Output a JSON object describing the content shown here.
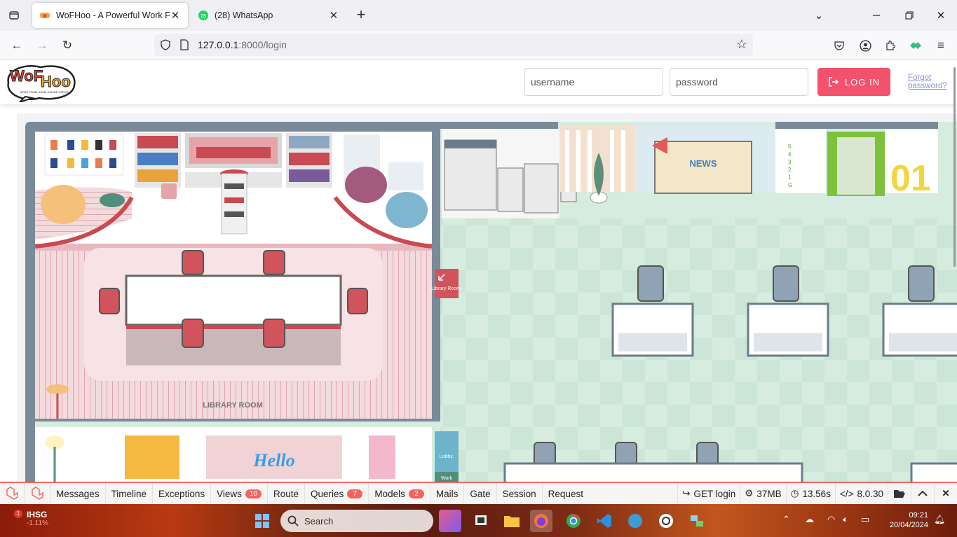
{
  "browser": {
    "tabs": [
      {
        "title": "WoFHoo - A Powerful Work From",
        "active": true
      },
      {
        "title": "(28) WhatsApp",
        "active": false,
        "badge": "28"
      }
    ],
    "url_host": "127.0.0.1",
    "url_rest": ":8000/login"
  },
  "header": {
    "logo_text_1": "WoF",
    "logo_text_2": "Hoo",
    "logo_tagline": "WORK FROM HOME ONLINE OFFICE",
    "username_placeholder": "username",
    "password_placeholder": "password",
    "login_label": "LOG IN",
    "forgot_label": "Forgot password?"
  },
  "office": {
    "library_label": "LIBRARY ROOM",
    "library_sign": "Library Room.",
    "lobby_sign": "Lobby.",
    "work_sign": "Work",
    "news_label": "NEWS",
    "hello_label": "Hello",
    "floor_numbers": [
      "5",
      "4",
      "3",
      "2",
      "1",
      "G"
    ],
    "floor_big": "01"
  },
  "debugbar": {
    "tabs": [
      {
        "label": "Messages"
      },
      {
        "label": "Timeline"
      },
      {
        "label": "Exceptions"
      },
      {
        "label": "Views",
        "badge": "10"
      },
      {
        "label": "Route"
      },
      {
        "label": "Queries",
        "badge": "7"
      },
      {
        "label": "Models",
        "badge": "2"
      },
      {
        "label": "Mails"
      },
      {
        "label": "Gate"
      },
      {
        "label": "Session"
      },
      {
        "label": "Request"
      }
    ],
    "route": "GET login",
    "memory": "37MB",
    "time": "13.56s",
    "php_version": "8.0.30"
  },
  "taskbar": {
    "stock_name": "IHSG",
    "stock_value": "-1.11%",
    "stock_badge": "1",
    "search_label": "Search",
    "time": "09:21",
    "date": "20/04/2024"
  },
  "colors": {
    "accent": "#f4516c",
    "debug_accent": "#f4645f",
    "library_floor": "#f1d3d6",
    "office_floor": "#d5ecdf"
  }
}
